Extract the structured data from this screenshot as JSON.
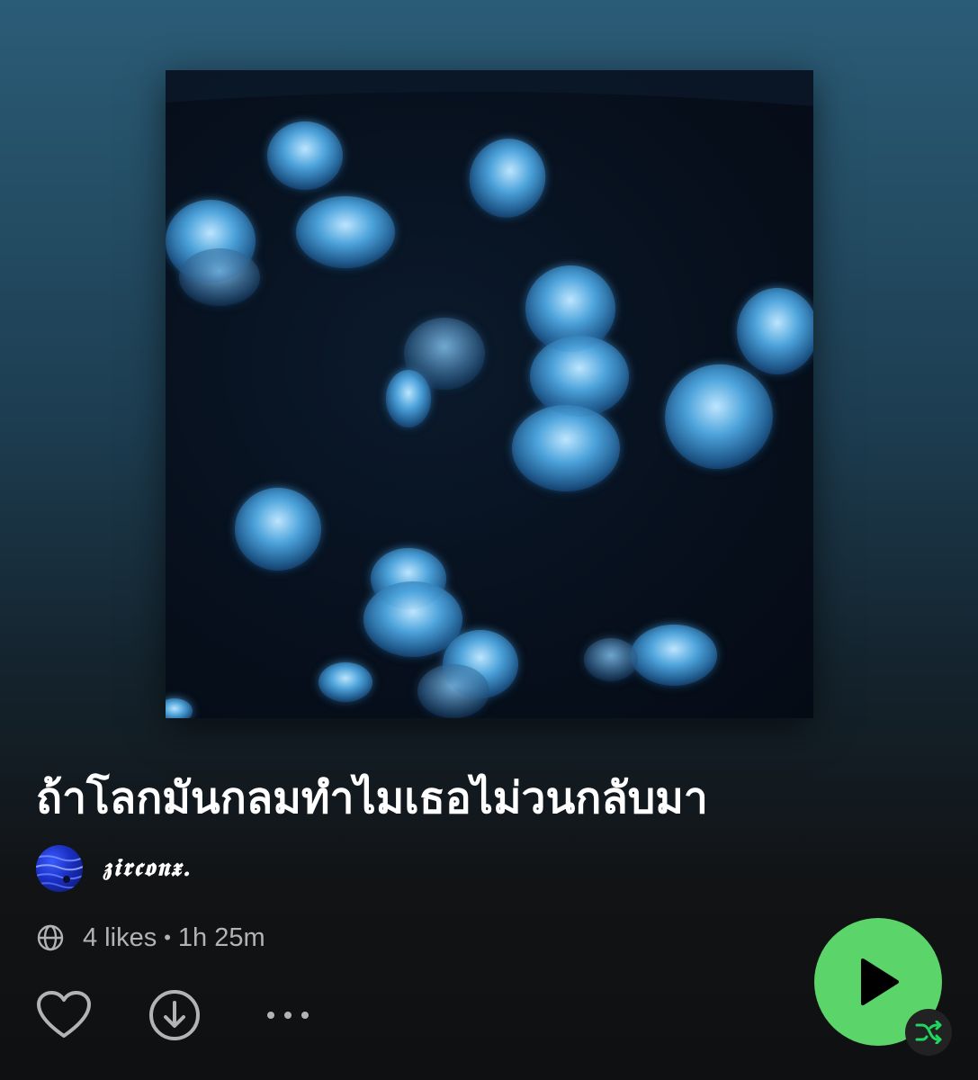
{
  "playlist": {
    "title": "ถ้าโลกมันกลมทำไมเธอไม่วนกลับมา",
    "owner": "𝖟𝖎𝖗𝖈𝖔𝖓𝖝.",
    "likes": "4 likes",
    "separator": "•",
    "duration": "1h 25m",
    "cover_description": "glowing blue jellyfish on dark water"
  },
  "icons": {
    "globe": "globe-icon",
    "like": "heart-outline-icon",
    "download": "download-circle-icon",
    "more": "more-horizontal-icon",
    "play": "play-icon",
    "shuffle": "shuffle-icon"
  },
  "colors": {
    "accent": "#1ed760",
    "play_button": "#5bd46a",
    "meta_text": "#b3b3b3",
    "shuffle_badge": "#222222",
    "shuffle_icon": "#1ed760"
  }
}
